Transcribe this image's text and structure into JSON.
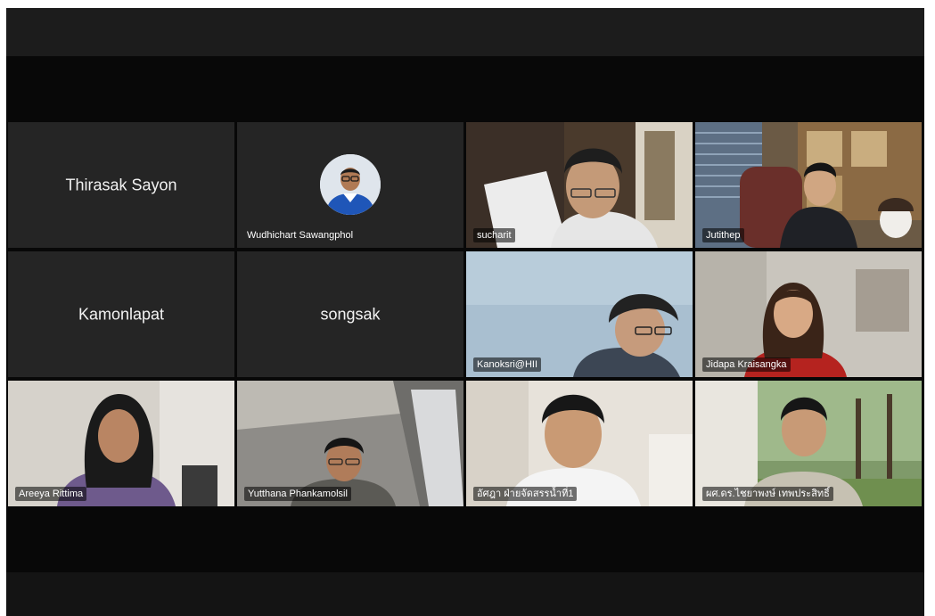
{
  "participants": [
    {
      "name": "Thirasak Sayon",
      "video": false
    },
    {
      "name": "Wudhichart Sawangphol",
      "video": false,
      "avatar": true
    },
    {
      "name": "sucharit",
      "video": true
    },
    {
      "name": "Jutithep",
      "video": true
    },
    {
      "name": "Kamonlapat",
      "video": false
    },
    {
      "name": "songsak",
      "video": false
    },
    {
      "name": "Kanoksri@HII",
      "video": true
    },
    {
      "name": "Jidapa Kraisangka",
      "video": true
    },
    {
      "name": "Areeya Rittima",
      "video": true
    },
    {
      "name": "Yutthana Phankamolsil",
      "video": true
    },
    {
      "name": "อัศฎา ฝ่ายจัดสรรน้ำที่1",
      "video": true
    },
    {
      "name": "ผศ.ดร.ไชยาพงษ์ เทพประสิทธิ์",
      "video": true
    }
  ],
  "colors": {
    "background": "#080808",
    "tile_background": "#252525",
    "name_text": "#ffffff"
  },
  "icons": {
    "avatar": "person-avatar-icon"
  }
}
